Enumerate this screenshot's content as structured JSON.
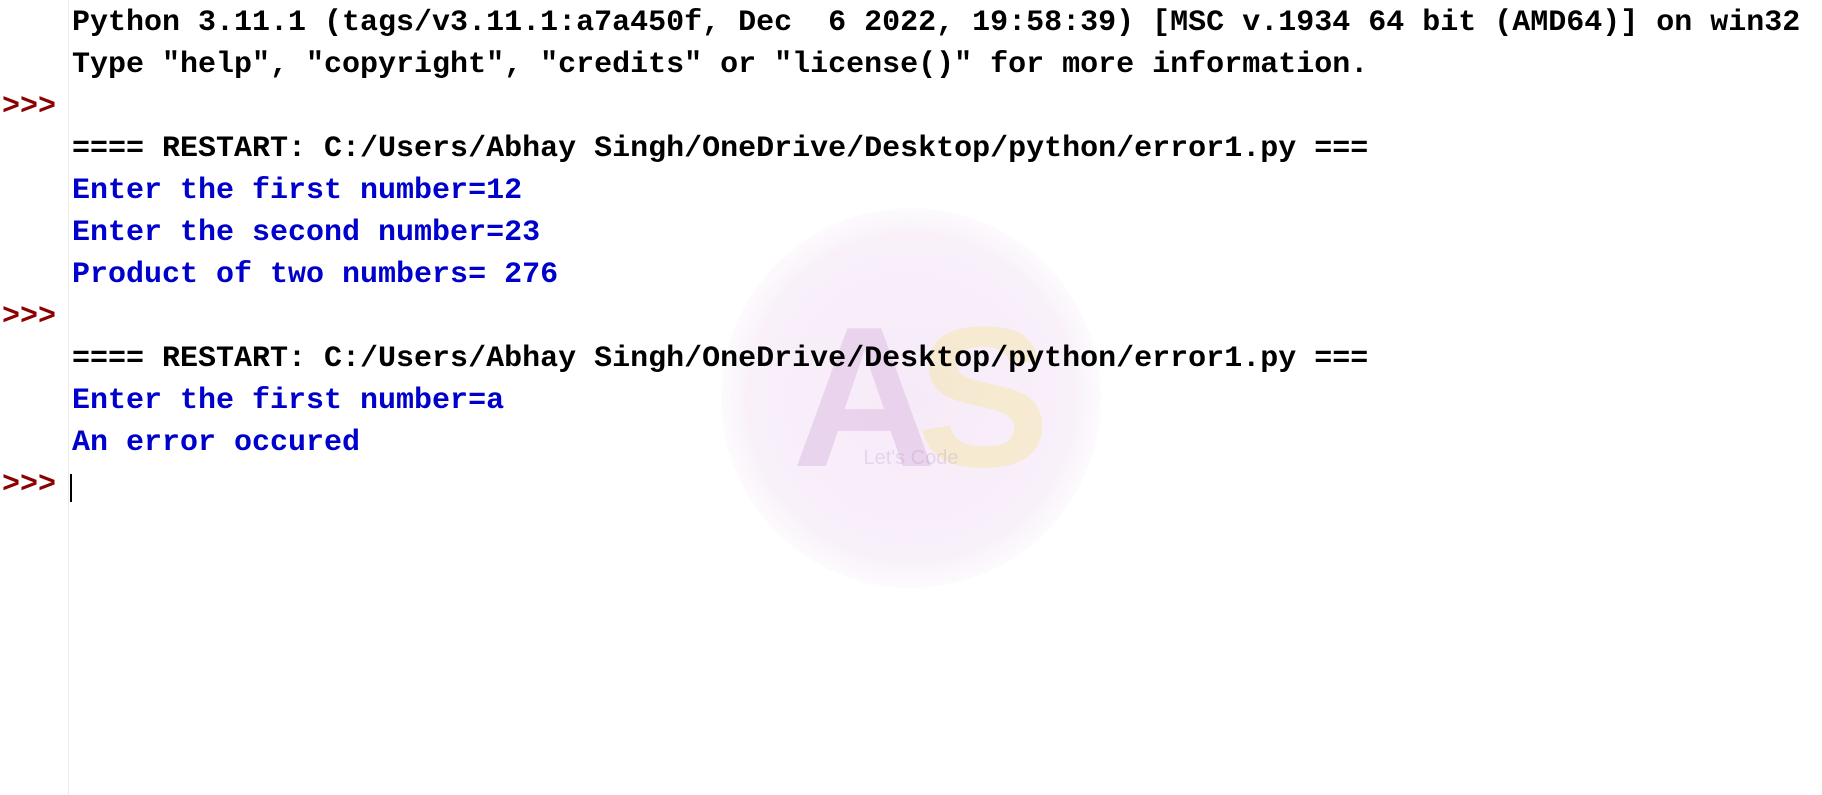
{
  "header": {
    "line1": "Python 3.11.1 (tags/v3.11.1:a7a450f, Dec  6 2022, 19:58:39) [MSC v.1934 64 bit (AMD64)] on win32",
    "line2": "Type \"help\", \"copyright\", \"credits\" or \"license()\" for more information."
  },
  "prompt": ">>>",
  "restart1": {
    "line1": "==== RESTART: C:/Users/Abhay Singh/OneDrive/Desktop/python/error1.py ==="
  },
  "output1": {
    "line1": "Enter the first number=12",
    "line2": "Enter the second number=23",
    "line3": "Product of two numbers= 276"
  },
  "restart2": {
    "line1": "==== RESTART: C:/Users/Abhay Singh/OneDrive/Desktop/python/error1.py ==="
  },
  "output2": {
    "line1": "Enter the first number=a",
    "line2": "An error occured"
  },
  "watermark": {
    "letter_a": "A",
    "letter_s": "S",
    "subtext": "Let's Code"
  }
}
